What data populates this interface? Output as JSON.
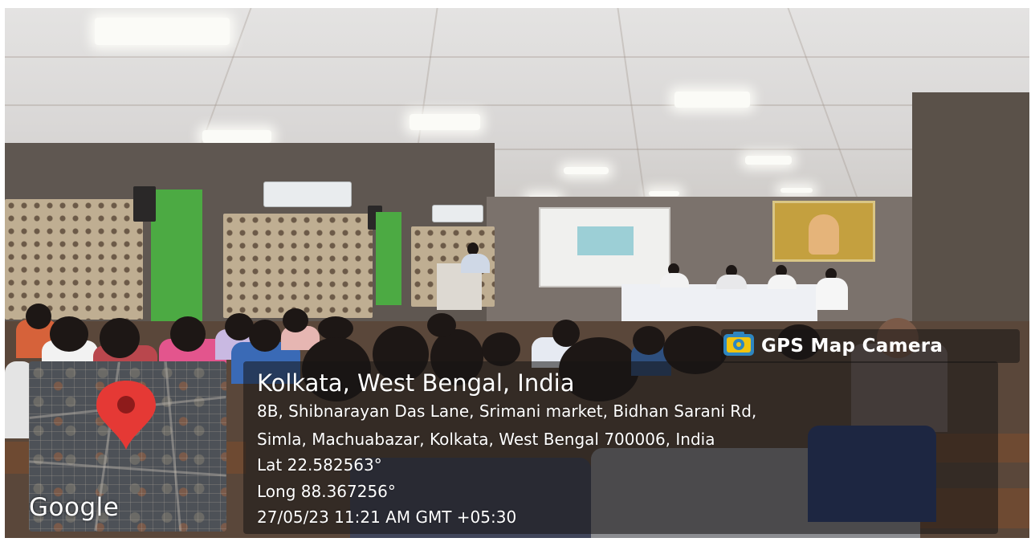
{
  "badge": {
    "label": "GPS Map Camera",
    "icon": "gps-map-camera-icon",
    "icon_colors": {
      "border": "#2e86c1",
      "fill": "#f1c40f"
    }
  },
  "location": {
    "title": "Kolkata, West Bengal, India",
    "address_line_1": "8B, Shibnarayan Das Lane, Srimani market, Bidhan Sarani Rd,",
    "address_line_2": "Simla, Machuabazar, Kolkata, West Bengal 700006, India",
    "latitude": "Lat 22.582563°",
    "longitude": "Long 88.367256°",
    "timestamp": "27/05/23 11:21 AM GMT +05:30"
  },
  "map": {
    "provider_label": "Google",
    "pin_icon": "map-pin-icon",
    "pin_color": "#e53935"
  }
}
